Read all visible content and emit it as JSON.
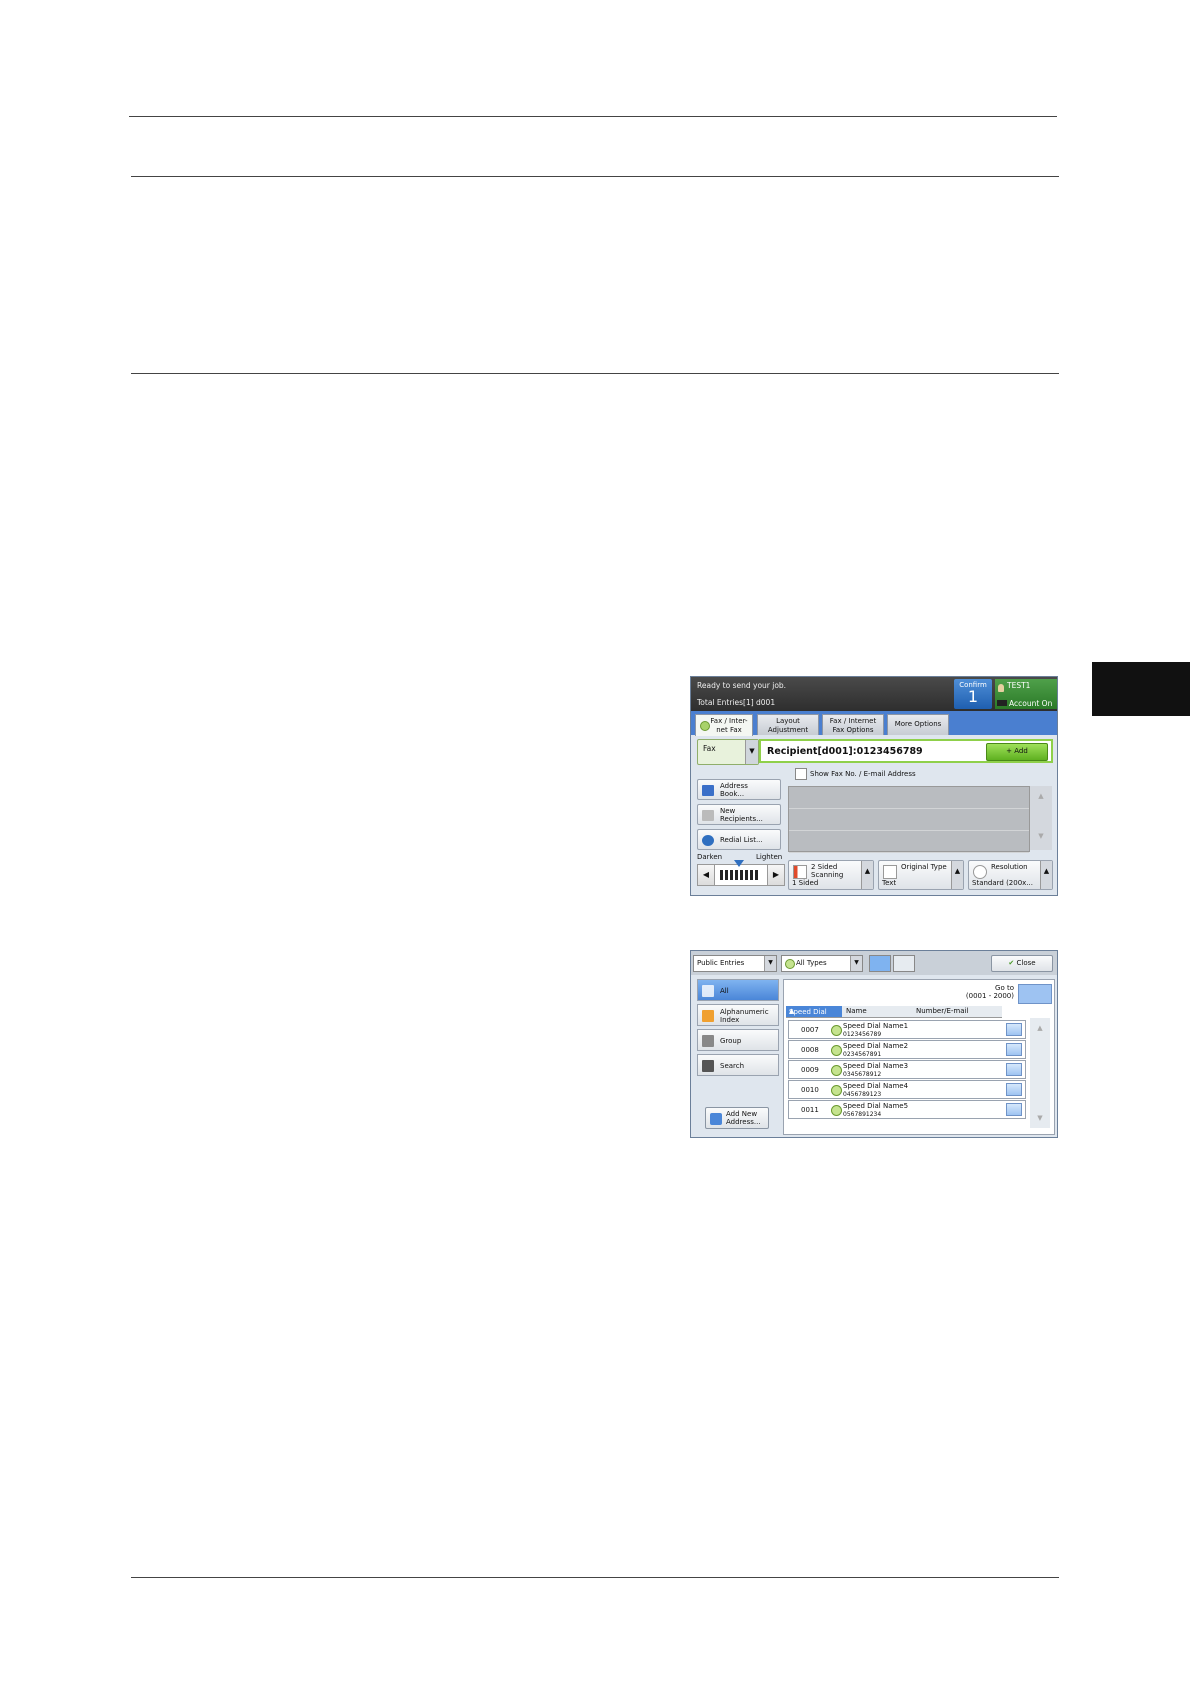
{
  "fax_screen": {
    "status": "Ready to send your job.",
    "total_entries": "Total Entries[1] d001",
    "confirm_label": "Confirm",
    "confirm_count": "1",
    "user": "TEST1",
    "account": "Account On",
    "tabs": [
      {
        "label": "Fax / Inter-\nnet Fax"
      },
      {
        "label": "Layout\nAdjustment"
      },
      {
        "label": "Fax / Internet\nFax Options"
      },
      {
        "label": "More Options"
      }
    ],
    "fax_select": "Fax",
    "recipient": "Recipient[d001]:0123456789",
    "add_button": "+ Add",
    "side_buttons": [
      {
        "label": "Address\nBook..."
      },
      {
        "label": "New\nRecipients..."
      },
      {
        "label": "Redial List..."
      }
    ],
    "show_checkbox": "Show Fax No. / E-mail Address",
    "darken": "Darken",
    "lighten": "Lighten",
    "bottom_buttons": [
      {
        "label": "2 Sided\nScanning",
        "value": "1 Sided"
      },
      {
        "label": "Original Type",
        "value": "Text"
      },
      {
        "label": "Resolution",
        "value": "Standard (200x..."
      }
    ]
  },
  "address_book": {
    "entries_select": "Public Entries",
    "types_select": "All Types",
    "close_button": "Close",
    "side_items": [
      {
        "label": "All"
      },
      {
        "label": "Alphanumeric\nIndex"
      },
      {
        "label": "Group"
      },
      {
        "label": "Search"
      }
    ],
    "add_new": "Add New\nAddress...",
    "goto_label": "Go to",
    "goto_range": "(0001 - 2000)",
    "columns": [
      "Speed Dial",
      "Name",
      "Number/E-mail"
    ],
    "rows": [
      {
        "speed_dial": "0007",
        "name": "Speed Dial Name1",
        "number": "0123456789"
      },
      {
        "speed_dial": "0008",
        "name": "Speed Dial Name2",
        "number": "0234567891"
      },
      {
        "speed_dial": "0009",
        "name": "Speed Dial Name3",
        "number": "0345678912"
      },
      {
        "speed_dial": "0010",
        "name": "Speed Dial Name4",
        "number": "0456789123"
      },
      {
        "speed_dial": "0011",
        "name": "Speed Dial Name5",
        "number": "0567891234"
      }
    ]
  }
}
